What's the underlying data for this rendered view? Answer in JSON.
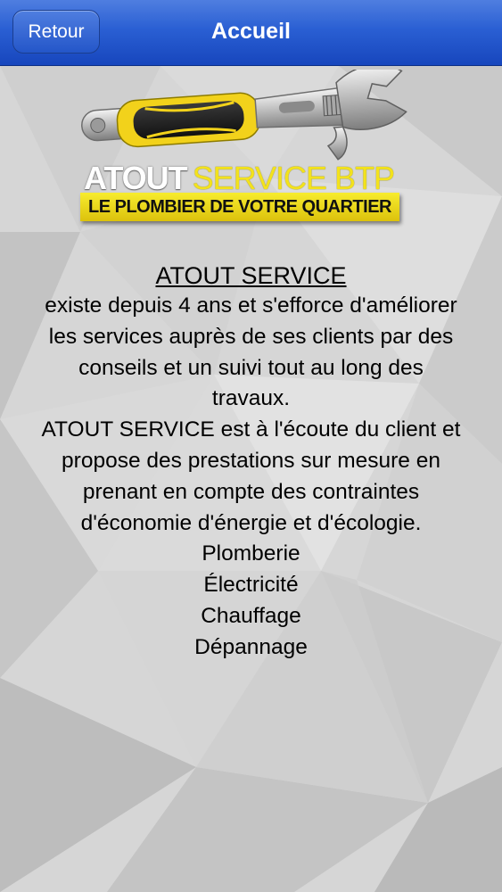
{
  "header": {
    "back_label": "Retour",
    "title": "Accueil"
  },
  "logo": {
    "word1": "ATOUT",
    "word2": "SERVICE BTP",
    "tagline": "LE PLOMBIER DE VOTRE QUARTIER"
  },
  "content": {
    "heading": "ATOUT SERVICE",
    "lines": [
      "existe depuis 4 ans et s'efforce d'améliorer",
      "les services auprès de ses clients par des",
      "conseils et un suivi tout au long des",
      "travaux.",
      "ATOUT SERVICE est à l'écoute du client et",
      "propose des prestations sur mesure en",
      "prenant en compte des contraintes",
      "d'économie d'énergie et d'écologie.",
      "Plomberie",
      "Électricité",
      "Chauffage",
      "Dépannage"
    ]
  },
  "colors": {
    "navbar": "#2a5fd3",
    "background": "#d9d9d9",
    "logo_yellow": "#f3e21c",
    "wrench_handle_yellow": "#f2d21b"
  },
  "icons": {
    "logo_graphic": "adjustable-wrench-icon"
  }
}
